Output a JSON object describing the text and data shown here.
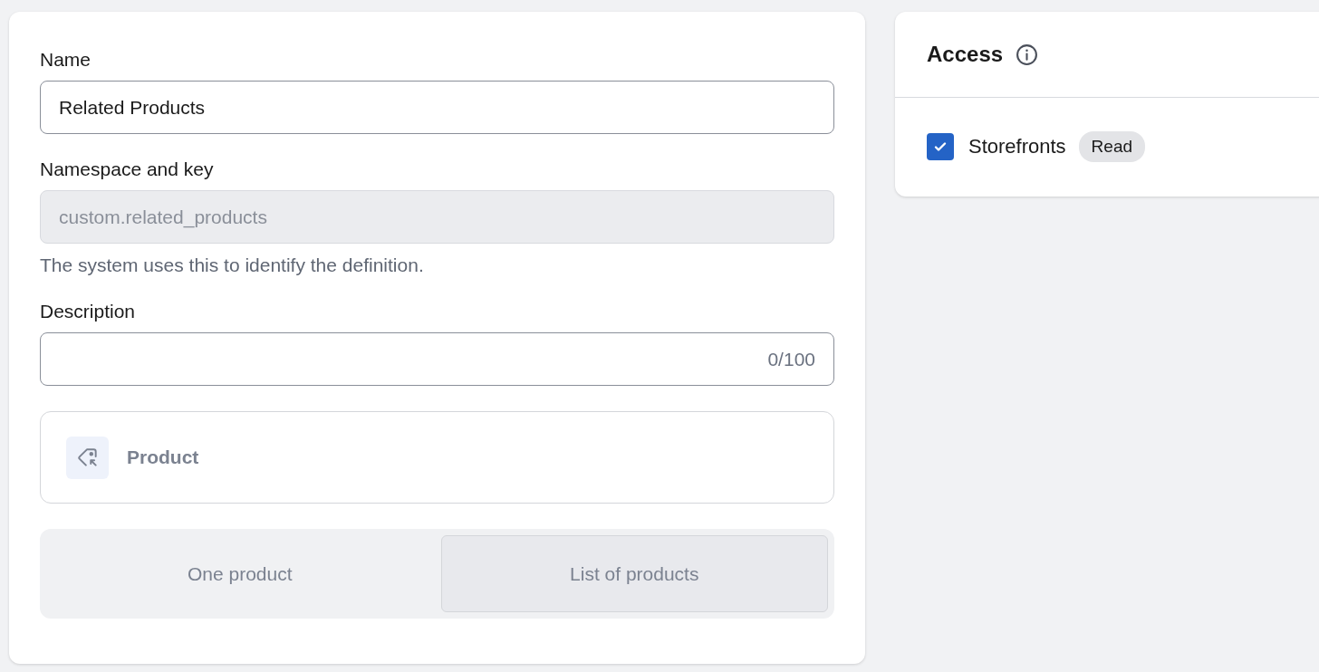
{
  "definition": {
    "name_field": {
      "label": "Name",
      "value": "Related Products"
    },
    "namespace_field": {
      "label": "Namespace and key",
      "value": "custom.related_products",
      "disabled": true,
      "help": "The system uses this to identify the definition."
    },
    "description_field": {
      "label": "Description",
      "counter": "0/100"
    },
    "type": {
      "label": "Product"
    },
    "cardinality": [
      {
        "label": "One product",
        "selected": false
      },
      {
        "label": "List of products",
        "selected": true
      }
    ]
  },
  "access": {
    "title": "Access",
    "items": [
      {
        "label": "Storefronts",
        "checked": true,
        "badge": "Read"
      }
    ]
  }
}
